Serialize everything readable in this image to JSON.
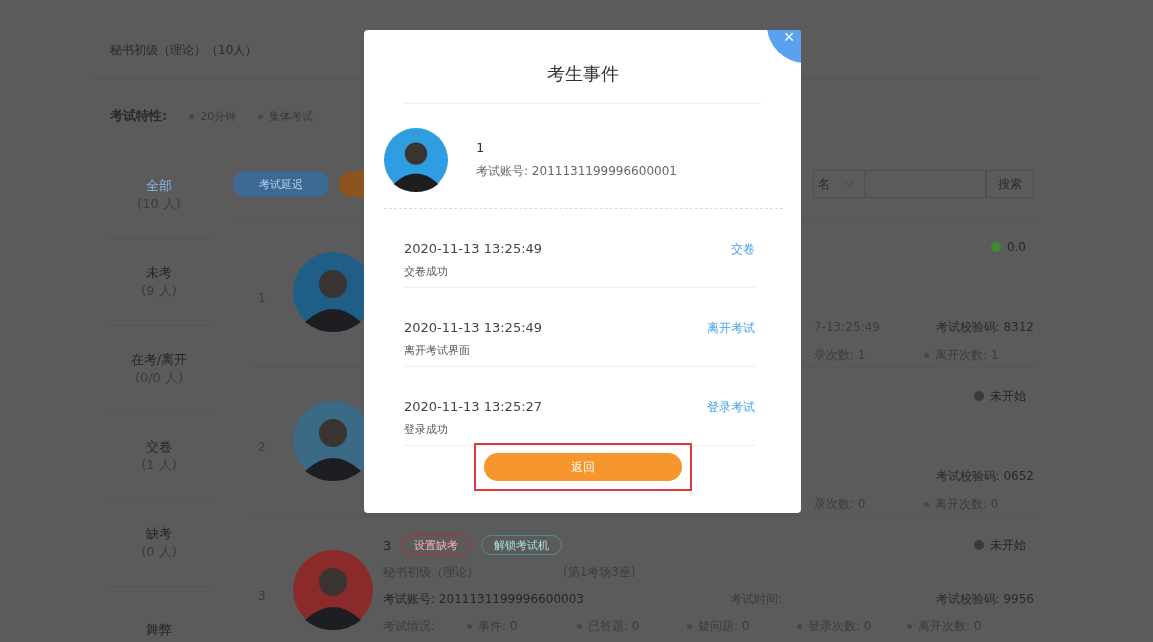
{
  "header": {
    "title": "秘书初级（理论）（10人）"
  },
  "features": {
    "label": "考试特性:",
    "items": [
      "20分钟",
      "集体考试"
    ]
  },
  "sidebar": {
    "items": [
      {
        "label": "全部",
        "count": "(10 人)",
        "selected": true
      },
      {
        "label": "未考",
        "count": "(9 人)",
        "selected": false
      },
      {
        "label": "在考/离开",
        "count": "(0/0 人)",
        "selected": false
      },
      {
        "label": "交卷",
        "count": "(1 人)",
        "selected": false
      },
      {
        "label": "缺考",
        "count": "(0 人)",
        "selected": false
      },
      {
        "label": "舞弊",
        "selected": false
      }
    ]
  },
  "toolbar": {
    "delay_button": "考试延迟",
    "filter_select": "名",
    "search_button": "搜索"
  },
  "rows": [
    {
      "kind": "covered",
      "index": "1",
      "status": {
        "text": "0.0",
        "color": "#3f8a2a"
      },
      "time_tail": "7-13:25:49",
      "check_code": "考试校验码: 8312",
      "stats": [
        "录次数: 1",
        "离开次数: 1"
      ]
    },
    {
      "kind": "covered",
      "index": "2",
      "status": {
        "text": "未开始",
        "color": "#3a3a3a"
      },
      "check_code": "考试校验码: 0652",
      "stats": [
        "录次数: 0",
        "离开次数: 0"
      ]
    },
    {
      "kind": "full",
      "index": "3",
      "status": {
        "text": "未开始",
        "color": "#3a3a3a"
      },
      "name": "3",
      "mark_absent": "设置缺考",
      "unlock": "解锁考试机",
      "exam": "秘书初级（理论）",
      "seat": "(第1考场3座)",
      "account": "考试账号: 2011131199996600003",
      "time_label": "考试时间:",
      "check_code": "考试校验码: 9956",
      "situation_label": "考试情况:",
      "stats": [
        "事件: 0",
        "已答题: 0",
        "疑问题: 0",
        "登录次数: 0",
        "离开次数: 0"
      ]
    }
  ],
  "modal": {
    "title": "考生事件",
    "close": "×",
    "name": "1",
    "account": "考试账号: 2011131199996600001",
    "events": [
      {
        "time": "2020-11-13 13:25:49",
        "description": "交卷成功",
        "action": "交卷"
      },
      {
        "time": "2020-11-13 13:25:49",
        "description": "离开考试界面",
        "action": "离开考试"
      },
      {
        "time": "2020-11-13 13:25:27",
        "description": "登录成功",
        "action": "登录考试"
      }
    ],
    "back_button": "返回"
  }
}
